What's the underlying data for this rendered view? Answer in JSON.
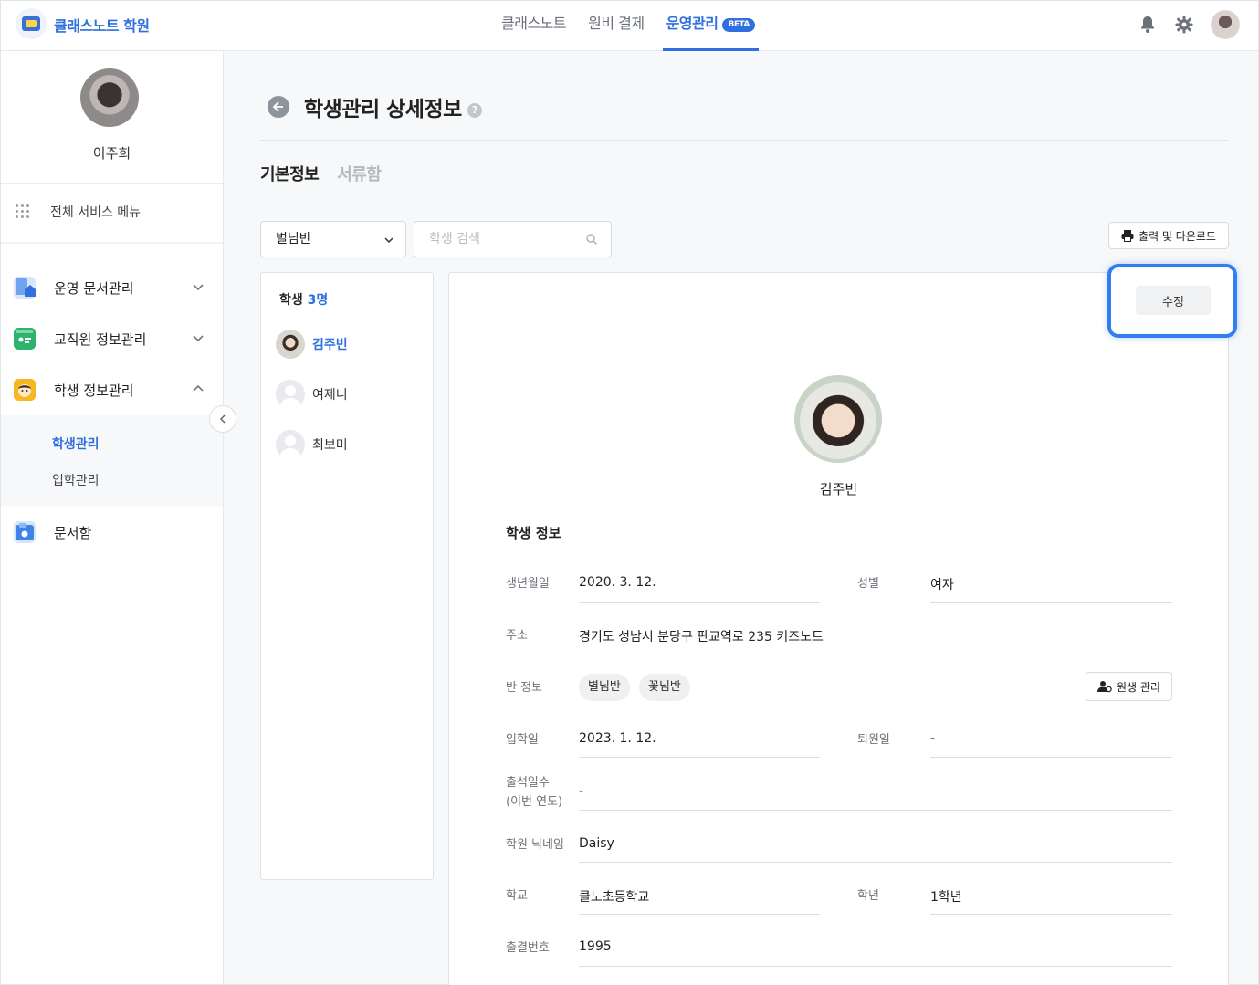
{
  "header": {
    "brand": "클래스노트 학원",
    "nav": [
      {
        "label": "클래스노트"
      },
      {
        "label": "원비 결제"
      },
      {
        "label": "운영관리",
        "badge": "BETA"
      }
    ],
    "icons": [
      "bell-icon",
      "gear-icon",
      "user-avatar"
    ]
  },
  "sidebar": {
    "profile_name": "이주희",
    "all_menu": "전체 서비스 메뉴",
    "items": [
      {
        "label": "운영 문서관리",
        "icon": "document-home-icon",
        "color": "#3f82e8"
      },
      {
        "label": "교직원 정보관리",
        "icon": "staff-card-icon",
        "color": "#2db36c"
      },
      {
        "label": "학생 정보관리",
        "icon": "student-face-icon",
        "color": "#f5b820"
      },
      {
        "label": "문서함",
        "icon": "document-box-icon",
        "color": "#3f82e8"
      }
    ],
    "sub_items": [
      {
        "label": "학생관리",
        "active": true
      },
      {
        "label": "입학관리",
        "active": false
      }
    ]
  },
  "page": {
    "title": "학생관리 상세정보",
    "tabs": [
      {
        "label": "기본정보",
        "active": true
      },
      {
        "label": "서류함",
        "active": false
      }
    ],
    "class_select": "별님반",
    "search_placeholder": "학생 검색",
    "print_label": "출력 및 다운로드"
  },
  "student_list": {
    "title_prefix": "학생 ",
    "count": "3명",
    "students": [
      {
        "name": "김주빈",
        "active": true
      },
      {
        "name": "여제니",
        "active": false
      },
      {
        "name": "최보미",
        "active": false
      }
    ]
  },
  "detail": {
    "edit_label": "수정",
    "name": "김주빈",
    "section_title": "학생 정보",
    "birth_label": "생년월일",
    "birth": "2020. 3. 12.",
    "gender_label": "성별",
    "gender": "여자",
    "address_label": "주소",
    "address": "경기도 성남시 분당구 판교역로 235 키즈노트",
    "class_label": "반 정보",
    "classes": [
      "별님반",
      "꽃님반"
    ],
    "class_mgmt_label": "원생 관리",
    "enroll_label": "입학일",
    "enroll": "2023. 1. 12.",
    "leave_label": "퇴원일",
    "leave": "-",
    "attendance_label_1": "출석일수",
    "attendance_label_2": "(이번 연도)",
    "attendance": "-",
    "nickname_label": "학원 닉네임",
    "nickname": "Daisy",
    "school_label": "학교",
    "school": "클노초등학교",
    "grade_label": "학년",
    "grade": "1학년",
    "attendance_no_label": "출결번호",
    "attendance_no": "1995"
  },
  "colors": {
    "accent": "#2f6fdf",
    "highlight": "#2f7ff0"
  }
}
